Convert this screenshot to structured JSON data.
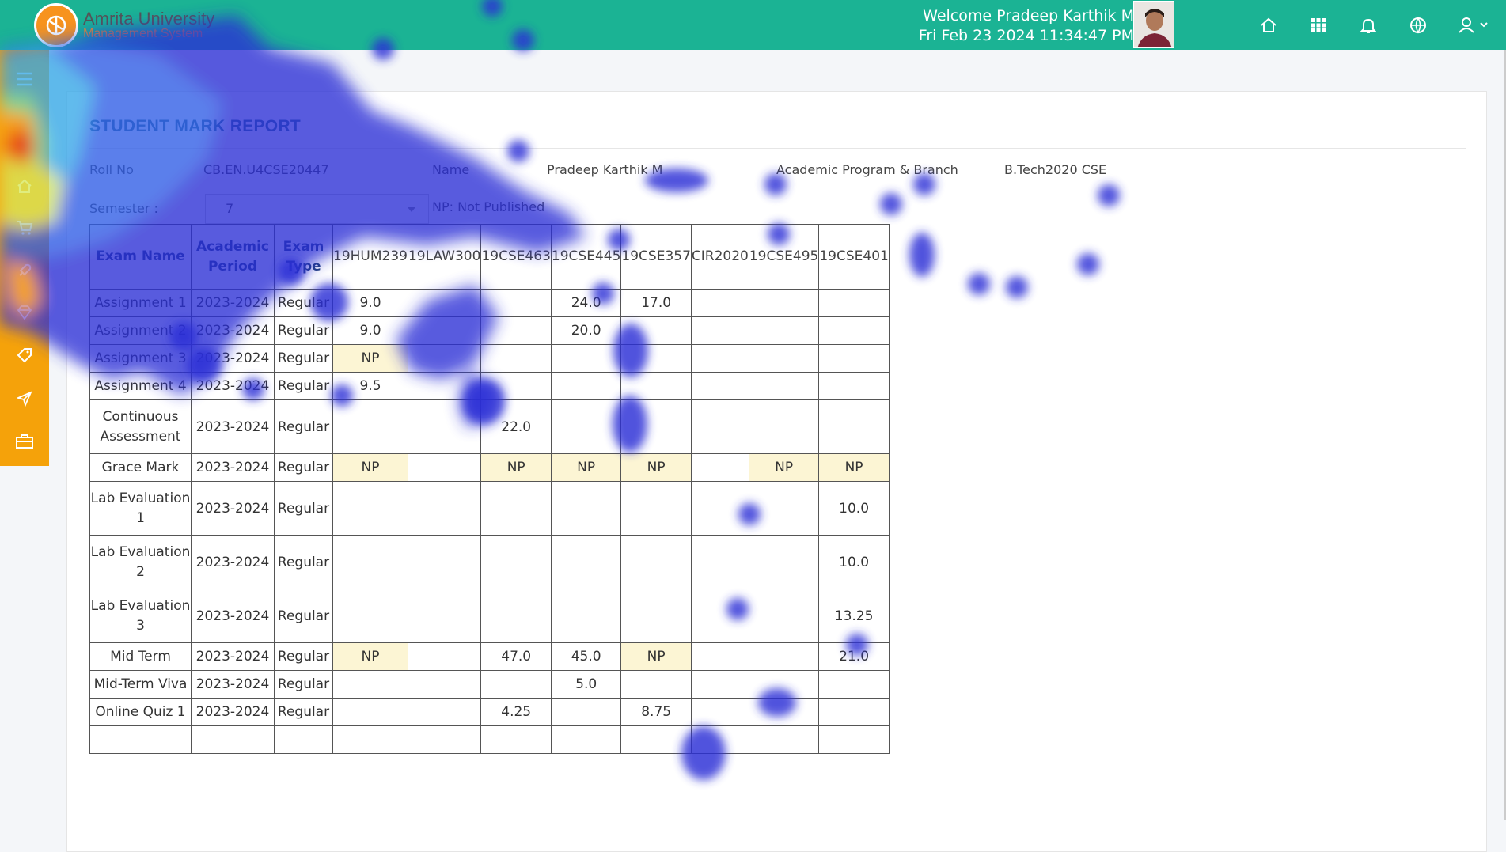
{
  "header": {
    "logo_line1": "Amrita University",
    "logo_line2": "Management System",
    "welcome": "Welcome Pradeep Karthik M",
    "datetime": "Fri Feb 23 2024 11:34:47 PM",
    "icons": [
      "home-icon",
      "apps-grid-icon",
      "bell-icon",
      "globe-icon",
      "user-icon"
    ]
  },
  "sidebar": {
    "items": [
      "menu-icon",
      "home-icon",
      "cart-icon",
      "rocket-icon",
      "diamond-icon",
      "tag-icon",
      "send-icon",
      "briefcase-icon"
    ]
  },
  "report": {
    "title": "STUDENT MARK REPORT",
    "roll_label": "Roll No",
    "roll_value": "CB.EN.U4CSE20447",
    "name_label": "Name",
    "name_value": "Pradeep Karthik M",
    "program_label": "Academic Program & Branch",
    "program_value": "B.Tech2020 CSE",
    "semester_label": "Semester :",
    "semester_value": "7",
    "np_note": "NP: Not Published"
  },
  "table": {
    "headers": [
      "Exam Name",
      "Academic Period",
      "Exam Type"
    ],
    "courses": [
      "19HUM239",
      "19LAW300",
      "19CSE463",
      "19CSE445",
      "19CSE357",
      "CIR2020",
      "19CSE495",
      "19CSE401"
    ],
    "rows": [
      {
        "name": "Assignment 1",
        "period": "2023-2024",
        "type": "Regular",
        "marks": [
          "9.0",
          "",
          "",
          "24.0",
          "17.0",
          "",
          "",
          ""
        ],
        "h": 35
      },
      {
        "name": "Assignment 2",
        "period": "2023-2024",
        "type": "Regular",
        "marks": [
          "9.0",
          "",
          "",
          "20.0",
          "",
          "",
          "",
          ""
        ],
        "h": 35
      },
      {
        "name": "Assignment 3",
        "period": "2023-2024",
        "type": "Regular",
        "marks": [
          "NP",
          "",
          "",
          "",
          "",
          "",
          "",
          ""
        ],
        "h": 35
      },
      {
        "name": "Assignment 4",
        "period": "2023-2024",
        "type": "Regular",
        "marks": [
          "9.5",
          "",
          "",
          "",
          "",
          "",
          "",
          ""
        ],
        "h": 35
      },
      {
        "name": "Continuous Assessment",
        "period": "2023-2024",
        "type": "Regular",
        "marks": [
          "",
          "",
          "22.0",
          "",
          "",
          "",
          "",
          ""
        ],
        "h": 68
      },
      {
        "name": "Grace Mark",
        "period": "2023-2024",
        "type": "Regular",
        "marks": [
          "NP",
          "",
          "NP",
          "NP",
          "NP",
          "",
          "NP",
          "NP"
        ],
        "h": 35
      },
      {
        "name": "Lab Evaluation 1",
        "period": "2023-2024",
        "type": "Regular",
        "marks": [
          "",
          "",
          "",
          "",
          "",
          "",
          "",
          "10.0"
        ],
        "h": 68
      },
      {
        "name": "Lab Evaluation 2",
        "period": "2023-2024",
        "type": "Regular",
        "marks": [
          "",
          "",
          "",
          "",
          "",
          "",
          "",
          "10.0"
        ],
        "h": 68
      },
      {
        "name": "Lab Evaluation 3",
        "period": "2023-2024",
        "type": "Regular",
        "marks": [
          "",
          "",
          "",
          "",
          "",
          "",
          "",
          "13.25"
        ],
        "h": 68
      },
      {
        "name": "Mid Term",
        "period": "2023-2024",
        "type": "Regular",
        "marks": [
          "NP",
          "",
          "47.0",
          "45.0",
          "NP",
          "",
          "",
          "21.0"
        ],
        "h": 35
      },
      {
        "name": "Mid-Term Viva",
        "period": "2023-2024",
        "type": "Regular",
        "marks": [
          "",
          "",
          "",
          "5.0",
          "",
          "",
          "",
          ""
        ],
        "h": 35
      },
      {
        "name": "Online Quiz 1",
        "period": "2023-2024",
        "type": "Regular",
        "marks": [
          "",
          "",
          "4.25",
          "",
          "8.75",
          "",
          "",
          ""
        ],
        "h": 35
      },
      {
        "name": "",
        "period": "",
        "type": "",
        "marks": [
          "",
          "",
          "",
          "",
          "",
          "",
          "",
          ""
        ],
        "h": 35
      }
    ]
  },
  "colors": {
    "topbar": "#1bb394",
    "sidebar": "#f5a20a",
    "np_cell": "#fcf5d4",
    "header_text": "#1f3e7a"
  }
}
